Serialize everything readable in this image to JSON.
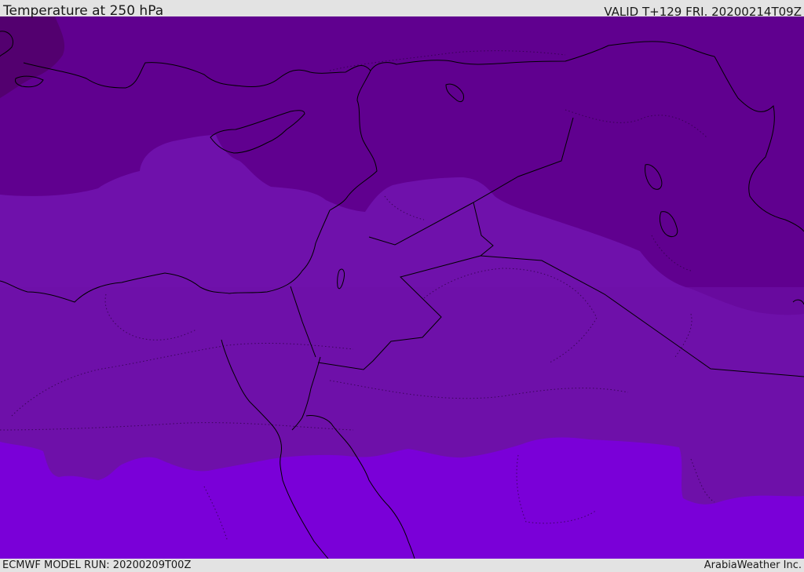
{
  "header": {
    "title": "Temperature at 250 hPa",
    "valid": "VALID T+129 FRI. 20200214T09Z"
  },
  "footer": {
    "model_run": "ECMWF MODEL RUN: 20200209T00Z",
    "credit": "ArabiaWeather Inc."
  },
  "map": {
    "variable": "temperature",
    "level": "250 hPa",
    "legend_shown": false,
    "colors": {
      "band_coldest": "#53006f",
      "band_cold": "#60008f",
      "band_mid": "#6f11ab",
      "band_mid_south": "#6e10a9",
      "band_warm": "#7a00d8",
      "coastline": "#000000",
      "border": "#000000"
    }
  }
}
